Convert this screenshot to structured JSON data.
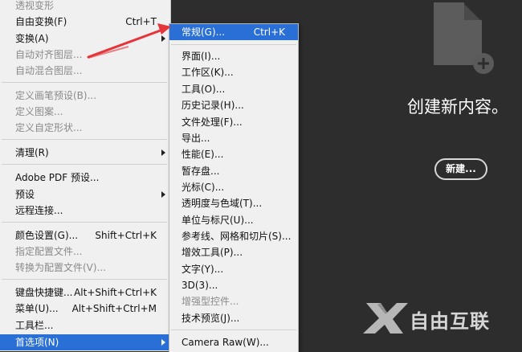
{
  "edit_menu": {
    "items": [
      {
        "label": "透视变形",
        "shortcut": "",
        "disabled": true
      },
      {
        "label": "自由变换(F)",
        "shortcut": "Ctrl+T",
        "disabled": false
      },
      {
        "label": "变换(A)",
        "shortcut": "",
        "disabled": false
      },
      {
        "label": "自动对齐图层...",
        "shortcut": "",
        "disabled": true
      },
      {
        "label": "自动混合图层...",
        "shortcut": "",
        "disabled": true
      },
      {
        "label": "定义画笔预设(B)...",
        "shortcut": "",
        "disabled": true
      },
      {
        "label": "定义图案...",
        "shortcut": "",
        "disabled": true
      },
      {
        "label": "定义自定形状...",
        "shortcut": "",
        "disabled": true
      },
      {
        "label": "清理(R)",
        "shortcut": "",
        "disabled": false
      },
      {
        "label": "Adobe PDF 预设...",
        "shortcut": "",
        "disabled": false
      },
      {
        "label": "预设",
        "shortcut": "",
        "disabled": false
      },
      {
        "label": "远程连接...",
        "shortcut": "",
        "disabled": false
      },
      {
        "label": "颜色设置(G)...",
        "shortcut": "Shift+Ctrl+K",
        "disabled": false
      },
      {
        "label": "指定配置文件...",
        "shortcut": "",
        "disabled": true
      },
      {
        "label": "转换为配置文件(V)...",
        "shortcut": "",
        "disabled": true
      },
      {
        "label": "键盘快捷键...",
        "shortcut": "Alt+Shift+Ctrl+K",
        "disabled": false
      },
      {
        "label": "菜单(U)...",
        "shortcut": "Alt+Shift+Ctrl+M",
        "disabled": false
      },
      {
        "label": "工具栏...",
        "shortcut": "",
        "disabled": false
      },
      {
        "label": "首选项(N)",
        "shortcut": "",
        "disabled": false
      }
    ]
  },
  "preferences_submenu": {
    "items": [
      {
        "label": "常规(G)...",
        "shortcut": "Ctrl+K",
        "disabled": false
      },
      {
        "label": "界面(I)...",
        "shortcut": "",
        "disabled": false
      },
      {
        "label": "工作区(K)...",
        "shortcut": "",
        "disabled": false
      },
      {
        "label": "工具(O)...",
        "shortcut": "",
        "disabled": false
      },
      {
        "label": "历史记录(H)...",
        "shortcut": "",
        "disabled": false
      },
      {
        "label": "文件处理(F)...",
        "shortcut": "",
        "disabled": false
      },
      {
        "label": "导出...",
        "shortcut": "",
        "disabled": false
      },
      {
        "label": "性能(E)...",
        "shortcut": "",
        "disabled": false
      },
      {
        "label": "暂存盘...",
        "shortcut": "",
        "disabled": false
      },
      {
        "label": "光标(C)...",
        "shortcut": "",
        "disabled": false
      },
      {
        "label": "透明度与色域(T)...",
        "shortcut": "",
        "disabled": false
      },
      {
        "label": "单位与标尺(U)...",
        "shortcut": "",
        "disabled": false
      },
      {
        "label": "参考线、网格和切片(S)...",
        "shortcut": "",
        "disabled": false
      },
      {
        "label": "增效工具(P)...",
        "shortcut": "",
        "disabled": false
      },
      {
        "label": "文字(Y)...",
        "shortcut": "",
        "disabled": false
      },
      {
        "label": "3D(3)...",
        "shortcut": "",
        "disabled": false
      },
      {
        "label": "增强型控件...",
        "shortcut": "",
        "disabled": true
      },
      {
        "label": "技术预览(J)...",
        "shortcut": "",
        "disabled": false
      },
      {
        "label": "Camera Raw(W)...",
        "shortcut": "",
        "disabled": false
      }
    ]
  },
  "start_panel": {
    "title": "创建新内容。",
    "new_button": "新建..."
  },
  "watermark": {
    "text": "自由互联"
  },
  "colors": {
    "accent": "#2a6fd6",
    "arrow": "#e5343a",
    "background": "#2d2d2d"
  }
}
